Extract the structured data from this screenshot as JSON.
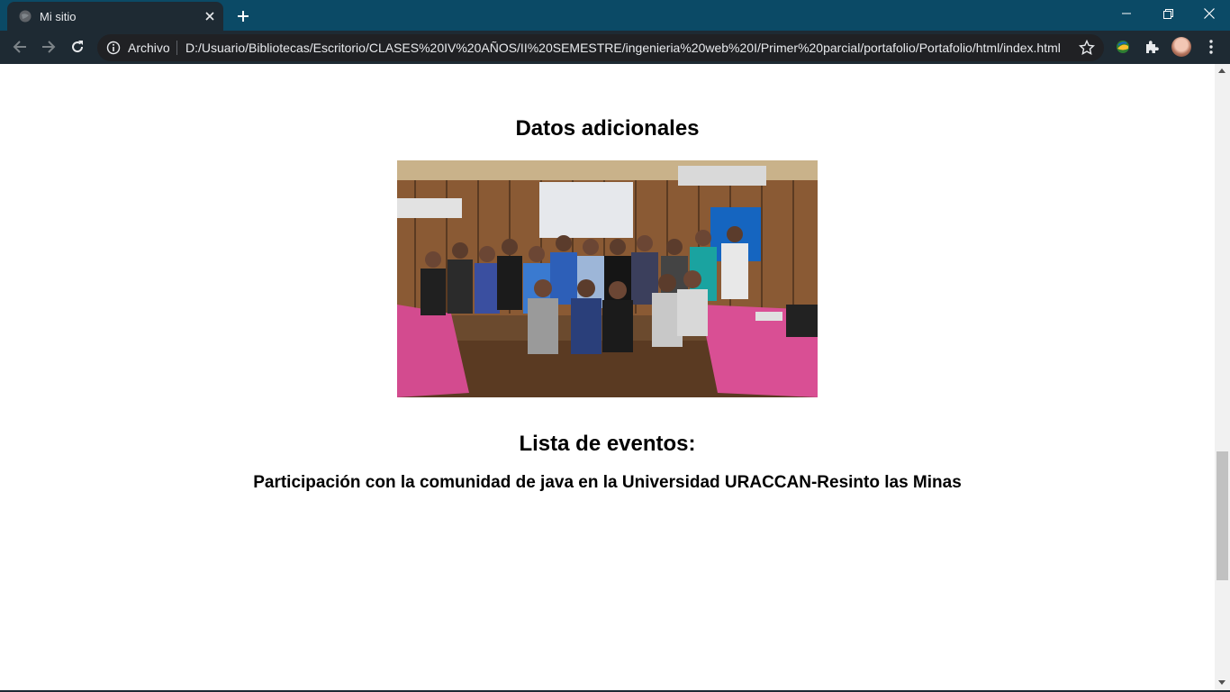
{
  "browser": {
    "tab_title": "Mi sitio",
    "security_chip": "Archivo",
    "url": "D:/Usuario/Bibliotecas/Escritorio/CLASES%20IV%20AÑOS/II%20SEMESTRE/ingenieria%20web%20I/Primer%20parcial/portafolio/Portafolio/html/index.html",
    "icons": [
      "globe-icon",
      "close-icon",
      "plus-icon",
      "minimize-icon",
      "restore-icon",
      "window-close-icon",
      "back-icon",
      "forward-icon",
      "reload-icon",
      "info-icon",
      "star-icon",
      "extension-icon",
      "puzzle-icon",
      "avatar"
    ]
  },
  "page": {
    "section_title": "Datos adicionales",
    "events_title": "Lista de eventos:",
    "event_item": "Participación con la comunidad de java en la Universidad URACCAN-Resinto las Minas"
  },
  "colors": {
    "titlebar": "#0b4a66",
    "toolbar": "#1e2a33",
    "omnibox": "#202124"
  }
}
